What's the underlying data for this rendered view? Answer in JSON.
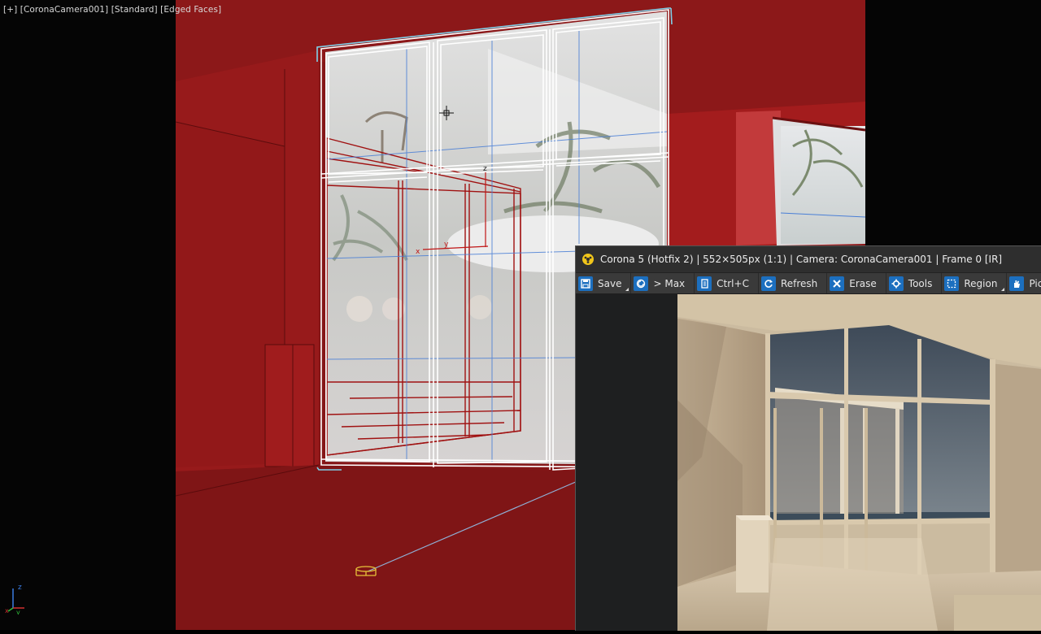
{
  "viewport": {
    "labels": [
      "[+]",
      "[CoronaCamera001]",
      "[Standard]",
      "[Edged Faces]"
    ],
    "axis": {
      "x": "x",
      "y": "y",
      "z": "z"
    },
    "gizmo_labels": {
      "x": "x",
      "y": "y",
      "z": "z"
    },
    "colors": {
      "background": "#851617",
      "wall": "#9a1b1c",
      "frame": "#ffffff",
      "selection": "#7fd0e8"
    }
  },
  "vfb": {
    "title": "Corona 5 (Hotfix 2) | 552×505px (1:1) | Camera: CoronaCamera001 | Frame 0 [IR]",
    "toolbar": [
      {
        "label": "Save",
        "icon": "save-icon",
        "caret": true
      },
      {
        "label": "> Max",
        "icon": "max-icon",
        "caret": false
      },
      {
        "label": "Ctrl+C",
        "icon": "copy-icon",
        "caret": false
      },
      {
        "label": "Refresh",
        "icon": "refresh-icon",
        "caret": false
      },
      {
        "label": "Erase",
        "icon": "erase-icon",
        "caret": false
      },
      {
        "label": "Tools",
        "icon": "gear-icon",
        "caret": false
      },
      {
        "label": "Region",
        "icon": "region-icon",
        "caret": true
      },
      {
        "label": "Pick",
        "icon": "hand-icon",
        "caret": false
      }
    ],
    "accent": "#1c6fbf"
  }
}
